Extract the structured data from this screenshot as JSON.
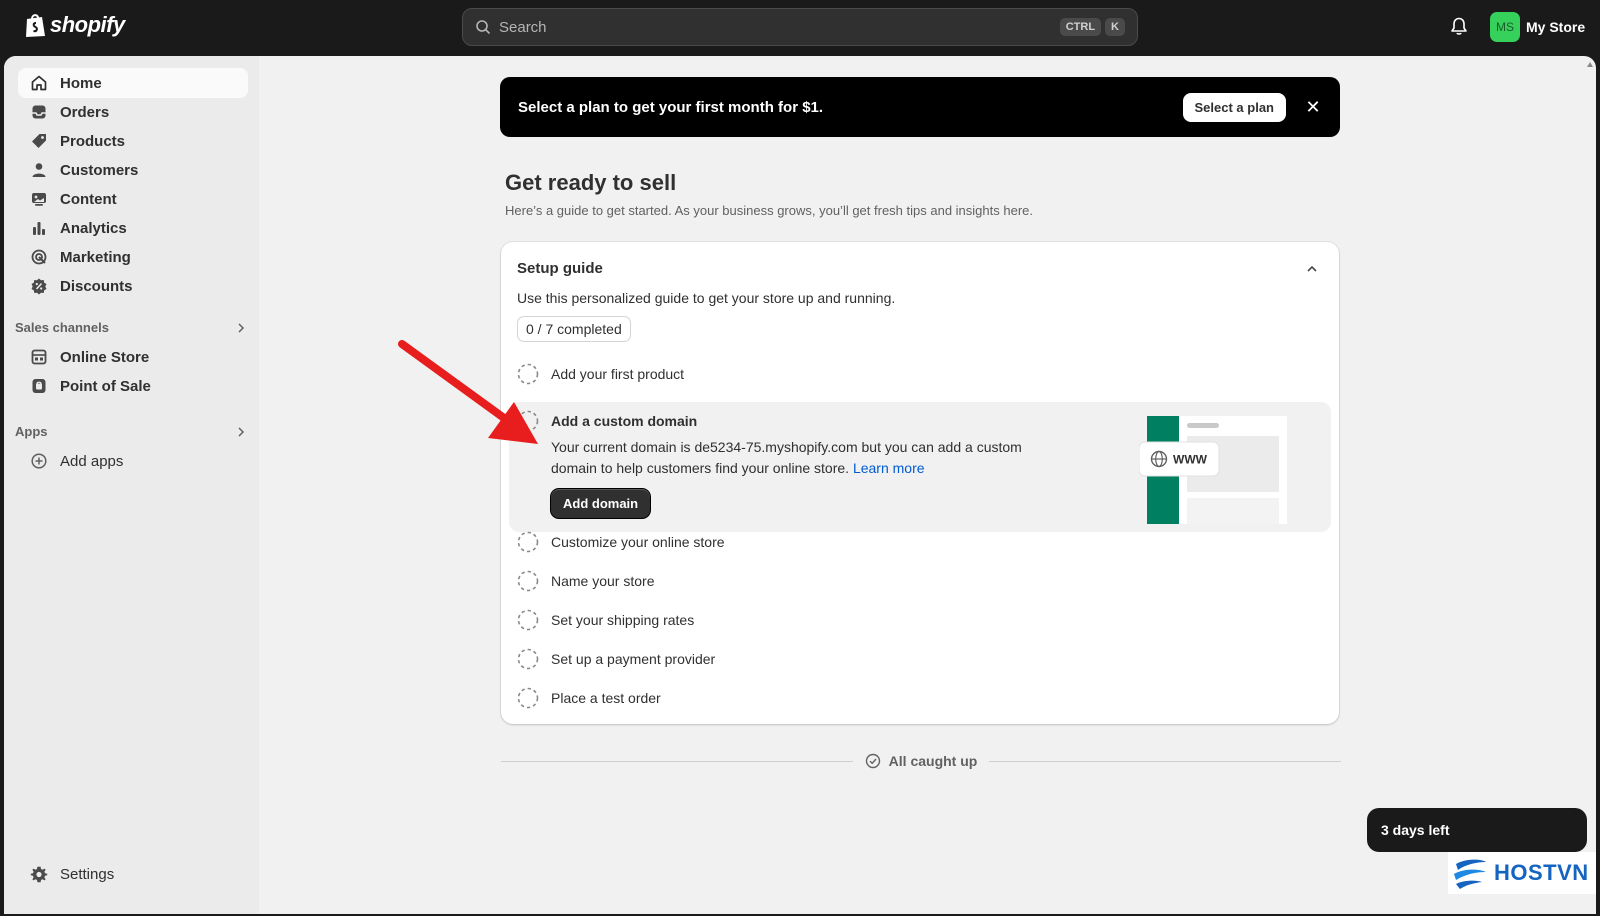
{
  "app": {
    "logo_text": "shopify"
  },
  "search": {
    "placeholder": "Search",
    "shortcut_1": "CTRL",
    "shortcut_2": "K"
  },
  "store": {
    "initials": "MS",
    "name": "My Store",
    "avatar_color": "#36d15b"
  },
  "sidebar": {
    "items": [
      {
        "label": "Home",
        "icon": "home-icon"
      },
      {
        "label": "Orders",
        "icon": "inbox-icon"
      },
      {
        "label": "Products",
        "icon": "tag-icon"
      },
      {
        "label": "Customers",
        "icon": "person-icon"
      },
      {
        "label": "Content",
        "icon": "image-icon"
      },
      {
        "label": "Analytics",
        "icon": "bar-chart-icon"
      },
      {
        "label": "Marketing",
        "icon": "target-icon"
      },
      {
        "label": "Discounts",
        "icon": "discount-icon"
      }
    ],
    "sales_channels_label": "Sales channels",
    "sales_channels": [
      {
        "label": "Online Store",
        "icon": "store-icon"
      },
      {
        "label": "Point of Sale",
        "icon": "pos-icon"
      }
    ],
    "apps_label": "Apps",
    "add_apps_label": "Add apps",
    "settings_label": "Settings"
  },
  "banner": {
    "text": "Select a plan to get your first month for $1.",
    "button_label": "Select a plan",
    "close_glyph": "✕"
  },
  "page": {
    "title": "Get ready to sell",
    "subtitle": "Here’s a guide to get started. As your business grows, you’ll get fresh tips and insights here."
  },
  "setup_guide": {
    "title": "Setup guide",
    "description": "Use this personalized guide to get your store up and running.",
    "progress": "0 / 7 completed",
    "tasks": [
      "Add your first product",
      "Add a custom domain",
      "Customize your online store",
      "Name your store",
      "Set your shipping rates",
      "Set up a payment provider",
      "Place a test order"
    ],
    "expanded": {
      "body_text": "Your current domain is de5234-75.myshopify.com but you can add a custom domain to help customers find your online store.",
      "link_text": "Learn more",
      "button_label": "Add domain",
      "illustration_text": "WWW"
    }
  },
  "footer": {
    "caught_up": "All caught up"
  },
  "trial": {
    "text": "3 days left"
  },
  "watermark": {
    "brand": "HOSTVN"
  },
  "colors": {
    "accent_green": "#008060",
    "link_blue": "#005bd3",
    "arrow_red": "#e81d1d"
  }
}
